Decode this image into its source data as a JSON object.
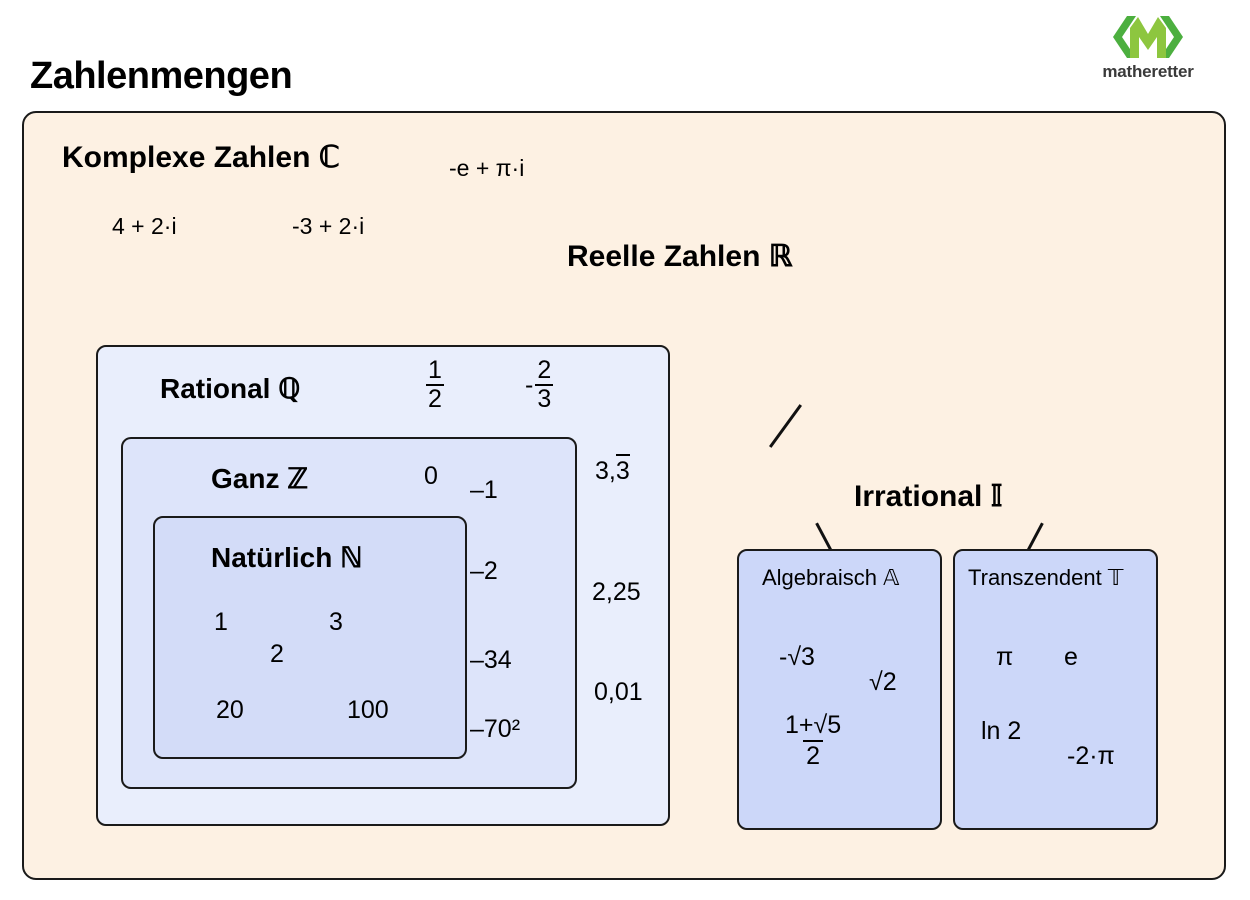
{
  "page": {
    "title": "Zahlenmengen",
    "background": "#ffffff"
  },
  "brand": {
    "name": "matheretter",
    "logo_icon": "matheretter-m-logo-icon",
    "colors": {
      "chevron_green": "#4caf3f",
      "m_green": "#8dc63f",
      "text": "#3a3a3a"
    }
  },
  "colors": {
    "complex_bg": "#fdf1e3",
    "rational_bg": "#e9eefc",
    "integer_bg": "#dde4fa",
    "natural_bg": "#d3dcf8",
    "irrational_child_bg": "#ccd7f9",
    "border": "#1a1a1a"
  },
  "complex": {
    "title": "Komplexe Zahlen ℂ",
    "examples": [
      "-e + π·i",
      "4 + 2·i",
      "-3 + 2·i"
    ]
  },
  "real": {
    "title": "Reelle Zahlen ℝ"
  },
  "rational": {
    "title": "Rational ℚ",
    "fractions": [
      {
        "sign": "",
        "numerator": "1",
        "denominator": "2"
      },
      {
        "sign": "-",
        "numerator": "2",
        "denominator": "3"
      }
    ],
    "decimals": {
      "periodic_lead": "3,",
      "periodic_repeat": "3",
      "values": [
        "2,25",
        "0,01"
      ]
    }
  },
  "integer": {
    "title": "Ganz ℤ",
    "values": [
      "0",
      "–1",
      "–2",
      "–34",
      "–70²"
    ]
  },
  "natural": {
    "title": "Natürlich ℕ",
    "values": [
      "1",
      "3",
      "2",
      "20",
      "100"
    ]
  },
  "irrational": {
    "title": "Irrational 𝕀",
    "algebraic": {
      "title": "Algebraisch 𝔸",
      "values": [
        "-√3",
        "√2"
      ],
      "fraction": {
        "numerator": "1+√5",
        "denominator": "2"
      }
    },
    "transcendent": {
      "title": "Transzendent 𝕋",
      "values": [
        "π",
        "e",
        "ln 2",
        "-2·π"
      ]
    }
  },
  "connectors": {
    "real_to_rational": "diagonal-line",
    "real_to_irrational": "diagonal-line",
    "irrational_to_algebraic": "diagonal-line",
    "irrational_to_transcendent": "diagonal-line"
  }
}
